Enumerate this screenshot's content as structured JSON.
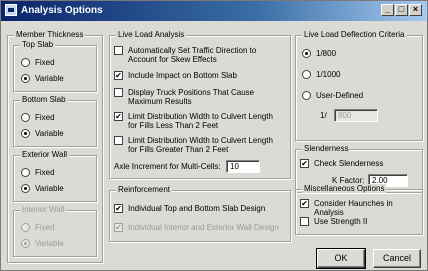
{
  "window": {
    "title": "Analysis Options",
    "min_label": "_",
    "max_label": "□",
    "close_label": "×"
  },
  "member_thickness": {
    "title": "Member Thickness",
    "top_slab": {
      "title": "Top Slab",
      "fixed": "Fixed",
      "variable": "Variable",
      "selected": "variable"
    },
    "bottom_slab": {
      "title": "Bottom Slab",
      "fixed": "Fixed",
      "variable": "Variable",
      "selected": "variable"
    },
    "exterior_wall": {
      "title": "Exterior Wall",
      "fixed": "Fixed",
      "variable": "Variable",
      "selected": "variable"
    },
    "interior_wall": {
      "title": "Interior Wall",
      "fixed": "Fixed",
      "variable": "Variable",
      "selected": "variable",
      "disabled": true
    }
  },
  "live_load_analysis": {
    "title": "Live Load Analysis",
    "options": [
      {
        "label_line1": "Automatically Set Traffic Direction to",
        "label_line2": "Account for Skew Effects",
        "checked": false
      },
      {
        "label_line1": "Include Impact on Bottom Slab",
        "label_line2": "",
        "checked": true
      },
      {
        "label_line1": "Display Truck Positions That Cause",
        "label_line2": "Maximum Results",
        "checked": false
      },
      {
        "label_line1": "Limit Distribution Width to Culvert Length",
        "label_line2": "for Fills Less Than 2 Feet",
        "checked": true
      },
      {
        "label_line1": "Limit Distribution Width to Culvert Length",
        "label_line2": "for Fills Greater Than 2 Feet",
        "checked": false
      }
    ],
    "axle_increment_label": "Axle Increment for Multi-Cells:",
    "axle_increment_value": "10"
  },
  "reinforcement": {
    "title": "Reinforcement",
    "individual_top_bottom": {
      "label": "Individual Top and Bottom Slab Design",
      "checked": true
    },
    "individual_walls": {
      "label": "Individual Interior and Exterior Wall Design",
      "checked": true,
      "disabled": true
    }
  },
  "deflection": {
    "title": "Live Load Deflection Criteria",
    "options": [
      "1/800",
      "1/1000",
      "User-Defined"
    ],
    "selected": "1/800",
    "user_prefix": "1/",
    "user_value": "800"
  },
  "slenderness": {
    "title": "Slenderness",
    "check_label": "Check Slenderness",
    "checked": true,
    "k_label": "K Factor:",
    "k_value": "2.00"
  },
  "misc": {
    "title": "Miscellaneous Options",
    "haunches_label": "Consider Haunches in Analysis",
    "haunches_checked": true,
    "strength_label": "Use Strength II",
    "strength_checked": false
  },
  "buttons": {
    "ok": "OK",
    "cancel": "Cancel"
  }
}
